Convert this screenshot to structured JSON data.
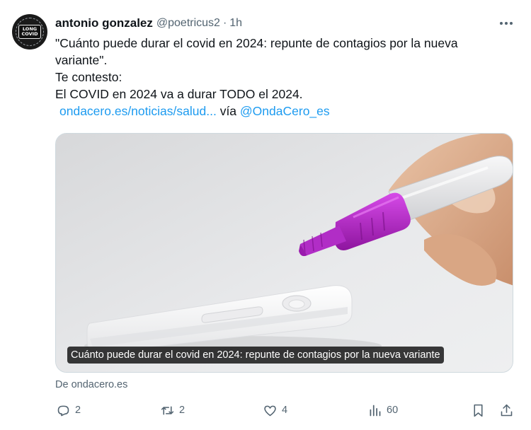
{
  "tweet": {
    "display_name": "antonio gonzalez",
    "handle": "@poetricus2",
    "separator": "·",
    "time": "1h",
    "avatar": {
      "text_line1": "LONG",
      "text_line2": "COVID",
      "icon": "long-covid-avatar"
    },
    "more_icon": "more-horizontal-icon",
    "text": {
      "line1": "\"Cuánto puede durar el covid en 2024: repunte de contagios por la nueva",
      "line2": "variante\".",
      "line3": "Te contesto:",
      "line4": "El COVID en 2024 va a durar TODO el 2024.",
      "link_url_text": "ondacero.es/noticias/salud...",
      "via": "vía",
      "mention": "@OndaCero_es"
    },
    "card": {
      "caption": "Cuánto puede durar el covid en 2024: repunte de contagios por la nueva variante",
      "source": "De ondacero.es"
    },
    "actions": {
      "replies": "2",
      "reposts": "2",
      "likes": "4",
      "views": "60"
    }
  },
  "colors": {
    "link": "#1d9bf0",
    "secondary_text": "#536471",
    "primary_text": "#0f1419",
    "test_cap": "#b01fc7"
  }
}
